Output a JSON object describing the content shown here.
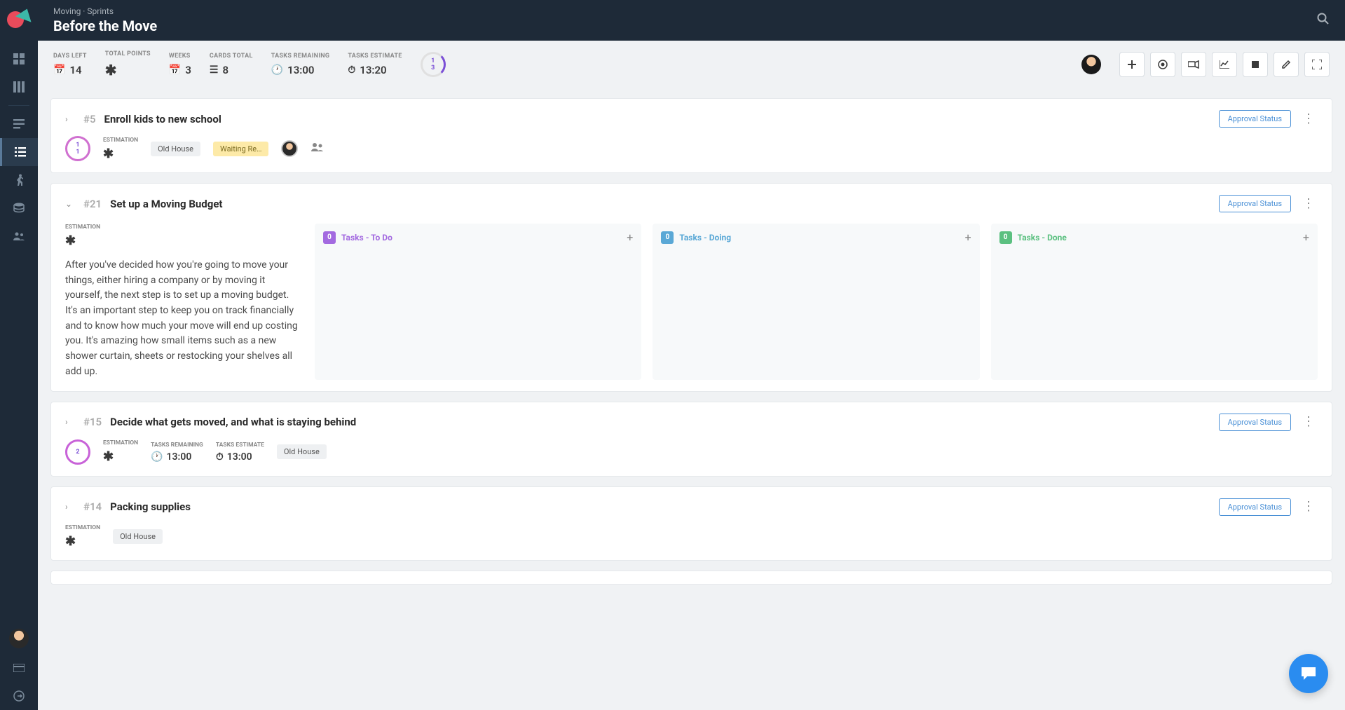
{
  "breadcrumb": "Moving · Sprints",
  "title": "Before the Move",
  "sidebar": {
    "icons": [
      "dashboard",
      "columns",
      "bars",
      "list",
      "run",
      "storage",
      "team",
      "avatar",
      "card",
      "exit"
    ]
  },
  "stats": {
    "days_left": {
      "lbl": "DAYS LEFT",
      "val": "14"
    },
    "total_points": {
      "lbl": "TOTAL POINTS",
      "val": "✱"
    },
    "weeks": {
      "lbl": "WEEKS",
      "val": "3"
    },
    "cards_total": {
      "lbl": "CARDS TOTAL",
      "val": "8"
    },
    "tasks_remaining": {
      "lbl": "TASKS REMAINING",
      "val": "13:00"
    },
    "tasks_estimate": {
      "lbl": "TASKS ESTIMATE",
      "val": "13:20"
    },
    "ring": {
      "top": "1",
      "bot": "3"
    }
  },
  "approval_label": "Approval Status",
  "cards": [
    {
      "id": "#5",
      "title": "Enroll kids to new school",
      "expanded": false,
      "ring": {
        "top": "1",
        "bot": "1"
      },
      "sub": [
        {
          "lbl": "ESTIMATION",
          "val": "✱",
          "ast": true
        }
      ],
      "tags": [
        {
          "t": "Old House",
          "c": ""
        },
        {
          "t": "Waiting Re…",
          "c": "yellow"
        }
      ],
      "avatar": true,
      "people": true
    },
    {
      "id": "#21",
      "title": "Set up a Moving Budget",
      "expanded": true,
      "sub": [
        {
          "lbl": "ESTIMATION",
          "val": "✱",
          "ast": true
        }
      ],
      "desc": "After you've decided how you're going to move your things, either hiring a company or by moving it yourself, the next step is to set up a moving budget. It's an important step to keep you on track financially and to know how much your move will end up costing you. It's amazing how small items such as a new shower curtain, sheets or restocking your shelves all add up.",
      "columns": [
        {
          "count": "0",
          "label": "Tasks - To Do",
          "color": "purple"
        },
        {
          "count": "0",
          "label": "Tasks - Doing",
          "color": "blue"
        },
        {
          "count": "0",
          "label": "Tasks - Done",
          "color": "green"
        }
      ]
    },
    {
      "id": "#15",
      "title": "Decide what gets moved, and what is staying behind",
      "expanded": false,
      "ring": {
        "top": "",
        "bot": "2"
      },
      "sub": [
        {
          "lbl": "ESTIMATION",
          "val": "✱",
          "ast": true
        },
        {
          "lbl": "TASKS REMAINING",
          "val": "13:00",
          "clock": true
        },
        {
          "lbl": "TASKS ESTIMATE",
          "val": "13:00",
          "clock2": true
        }
      ],
      "tags": [
        {
          "t": "Old House",
          "c": ""
        }
      ]
    },
    {
      "id": "#14",
      "title": "Packing supplies",
      "expanded": false,
      "sub": [
        {
          "lbl": "ESTIMATION",
          "val": "✱",
          "ast": true
        }
      ],
      "tags": [
        {
          "t": "Old House",
          "c": ""
        }
      ]
    }
  ]
}
